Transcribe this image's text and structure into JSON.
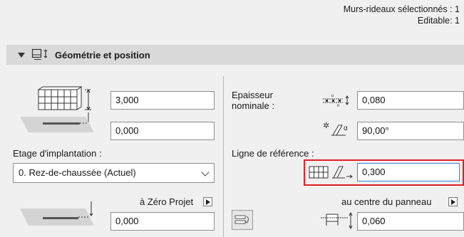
{
  "selection": {
    "line1": "Murs-rideaux sélectionnés : 1",
    "line2": "Editable: 1"
  },
  "section": {
    "title": "Géométrie et position"
  },
  "left": {
    "height_value": "3,000",
    "base_offset_value": "0,000",
    "story_label": "Etage d'implantation :",
    "story_selected": "0. Rez-de-chaussée (Actuel)",
    "zero_label": "à Zéro Projet",
    "zero_value": "0,000"
  },
  "right": {
    "thickness_label_1": "Epaisseur",
    "thickness_label_2": "nominale :",
    "thickness_value": "0,080",
    "angle_value": "90,00°",
    "ref_line_label": "Ligne de référence :",
    "ref_offset_value": "0,300",
    "panel_label": "au centre du panneau",
    "panel_value": "0,060"
  },
  "colors": {
    "highlight": "#e0202a",
    "header_bg": "#d9d9d9"
  }
}
